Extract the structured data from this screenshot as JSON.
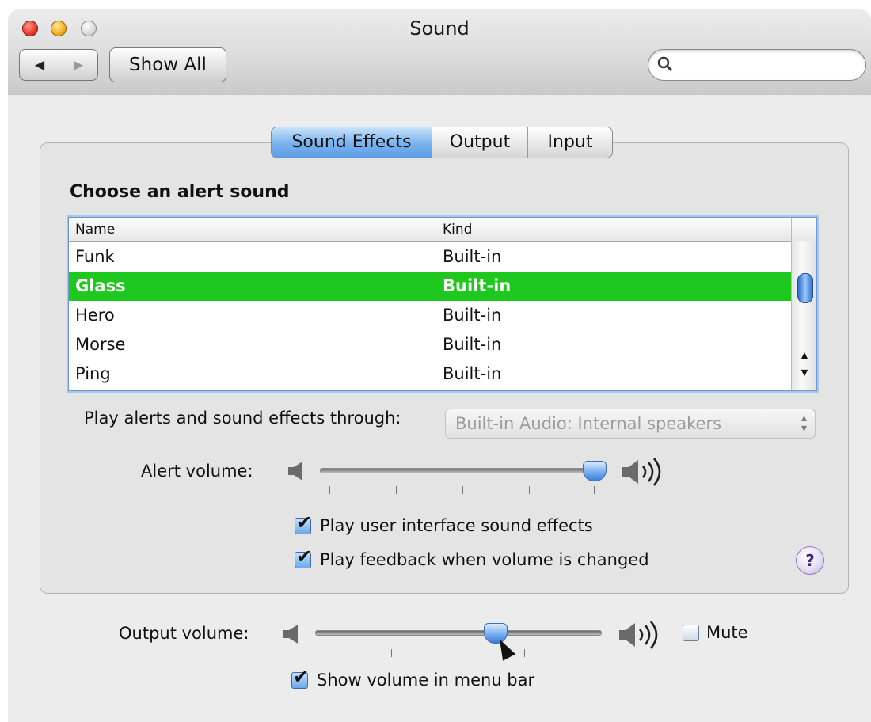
{
  "window": {
    "title": "Sound"
  },
  "toolbar": {
    "back_icon": "◀",
    "forward_icon": "▶",
    "show_all_label": "Show All",
    "search_icon": "🔍",
    "search_value": ""
  },
  "tabs": [
    {
      "label": "Sound Effects",
      "active": true
    },
    {
      "label": "Output",
      "active": false
    },
    {
      "label": "Input",
      "active": false
    }
  ],
  "alerts": {
    "heading": "Choose an alert sound",
    "columns": [
      "Name",
      "Kind"
    ],
    "rows": [
      {
        "name": "Funk",
        "kind": "Built-in",
        "selected": false
      },
      {
        "name": "Glass",
        "kind": "Built-in",
        "selected": true
      },
      {
        "name": "Hero",
        "kind": "Built-in",
        "selected": false
      },
      {
        "name": "Morse",
        "kind": "Built-in",
        "selected": false
      },
      {
        "name": "Ping",
        "kind": "Built-in",
        "selected": false
      }
    ],
    "selection_color": "#1fc81f"
  },
  "play_through": {
    "label": "Play alerts and sound effects through:",
    "value": "Built-in Audio: Internal speakers"
  },
  "alert_volume": {
    "label": "Alert volume:",
    "level": 1.0
  },
  "checkboxes": {
    "ui_effects": {
      "label": "Play user interface sound effects",
      "checked": true
    },
    "feedback": {
      "label": "Play feedback when volume is changed",
      "checked": true
    },
    "show_in_menubar": {
      "label": "Show volume in menu bar",
      "checked": true
    },
    "mute": {
      "label": "Mute",
      "checked": false
    }
  },
  "output_volume": {
    "label": "Output volume:",
    "level": 0.63
  },
  "help": {
    "label": "?"
  },
  "icons": {
    "speaker_low": "speaker-low-icon",
    "speaker_high": "speaker-high-icon",
    "checkmark": "✔"
  }
}
